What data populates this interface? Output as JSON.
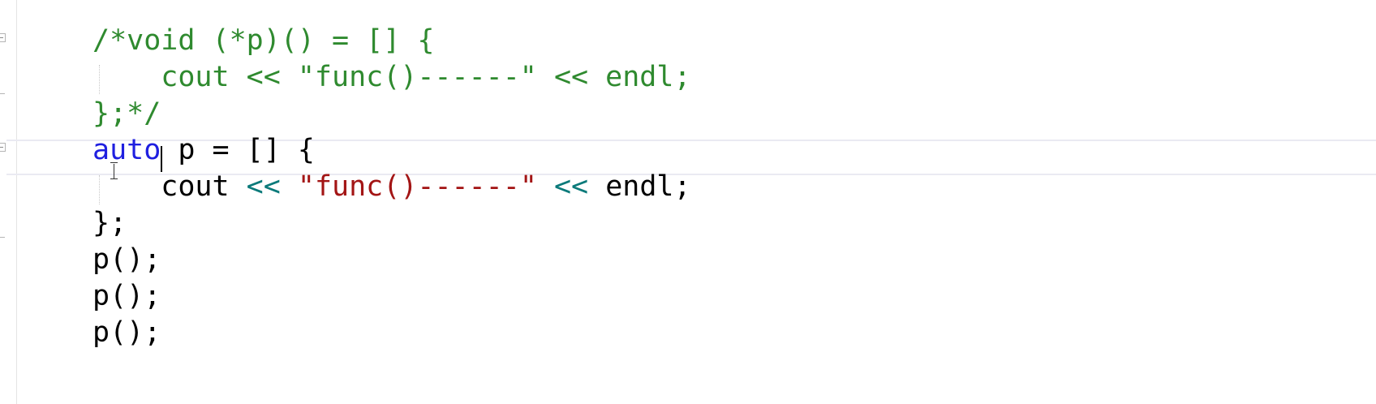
{
  "editor": {
    "lines": [
      [
        {
          "text": "/*void (*p)() = [] {",
          "cls": "c-comment"
        }
      ],
      [
        {
          "text": "    cout << \"func()------\" << endl;",
          "cls": "c-comment"
        }
      ],
      [
        {
          "text": "};*/",
          "cls": "c-comment"
        }
      ],
      [
        {
          "text": "auto",
          "cls": "c-keyword"
        },
        {
          "text": " p = [] {",
          "cls": "c-plain"
        }
      ],
      [
        {
          "text": "    cout ",
          "cls": "c-plain"
        },
        {
          "text": "<<",
          "cls": "c-operator"
        },
        {
          "text": " ",
          "cls": "c-plain"
        },
        {
          "text": "\"func()------\"",
          "cls": "c-string"
        },
        {
          "text": " ",
          "cls": "c-plain"
        },
        {
          "text": "<<",
          "cls": "c-operator"
        },
        {
          "text": " endl;",
          "cls": "c-plain"
        }
      ],
      [
        {
          "text": "};",
          "cls": "c-plain"
        }
      ],
      [
        {
          "text": "p();",
          "cls": "c-plain"
        }
      ],
      [
        {
          "text": "p();",
          "cls": "c-plain"
        }
      ],
      [
        {
          "text": "p();",
          "cls": "c-plain"
        }
      ]
    ],
    "current_line_index": 3
  },
  "colors": {
    "comment": "#2f8a2f",
    "keyword": "#1f1fe0",
    "string": "#a31515",
    "operator": "#0b7a7a",
    "plain": "#000000",
    "background": "#ffffff"
  },
  "icons": [
    "fold-toggle-icon",
    "text-cursor-icon"
  ]
}
